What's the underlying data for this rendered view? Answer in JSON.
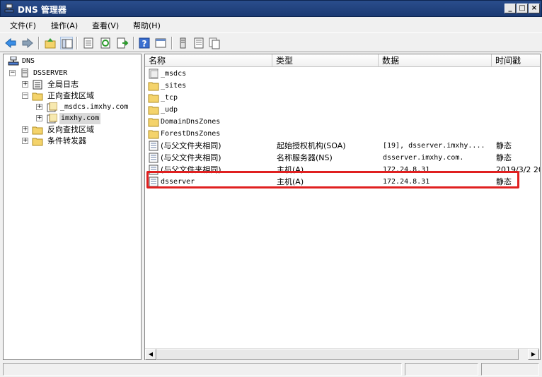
{
  "window": {
    "title": "DNS 管理器"
  },
  "menu": [
    "文件(F)",
    "操作(A)",
    "查看(V)",
    "帮助(H)"
  ],
  "tree": {
    "root": "DNS",
    "server": "DSSERVER",
    "global_logs": "全局日志",
    "forward_zones": "正向查找区域",
    "msdcs_zone": "_msdcs.imxhy.com",
    "imxhy_zone": "imxhy.com",
    "reverse_zones": "反向查找区域",
    "conditional_forwarders": "条件转发器"
  },
  "list": {
    "columns": [
      "名称",
      "类型",
      "数据",
      "时间戳"
    ],
    "rows": [
      {
        "name": "_msdcs",
        "type": "",
        "data": "",
        "ts": "",
        "icon": "folder-icon"
      },
      {
        "name": "_sites",
        "type": "",
        "data": "",
        "ts": "",
        "icon": "folder-icon"
      },
      {
        "name": "_tcp",
        "type": "",
        "data": "",
        "ts": "",
        "icon": "folder-icon"
      },
      {
        "name": "_udp",
        "type": "",
        "data": "",
        "ts": "",
        "icon": "folder-icon"
      },
      {
        "name": "DomainDnsZones",
        "type": "",
        "data": "",
        "ts": "",
        "icon": "folder-icon"
      },
      {
        "name": "ForestDnsZones",
        "type": "",
        "data": "",
        "ts": "",
        "icon": "folder-icon"
      },
      {
        "name": "(与父文件夹相同)",
        "type": "起始授权机构(SOA)",
        "data": "[19], dsserver.imxhy....",
        "ts": "静态",
        "icon": "record-icon"
      },
      {
        "name": "(与父文件夹相同)",
        "type": "名称服务器(NS)",
        "data": "dsserver.imxhy.com.",
        "ts": "静态",
        "icon": "record-icon"
      },
      {
        "name": "(与父文件夹相同)",
        "type": "主机(A)",
        "data": "172.24.8.31",
        "ts": "2019/3/2 20",
        "icon": "record-icon"
      },
      {
        "name": "dsserver",
        "type": "主机(A)",
        "data": "172.24.8.31",
        "ts": "静态",
        "icon": "record-icon"
      }
    ]
  },
  "colors": {
    "highlight": "#e02020",
    "title_bar": "#1f3f7a"
  }
}
